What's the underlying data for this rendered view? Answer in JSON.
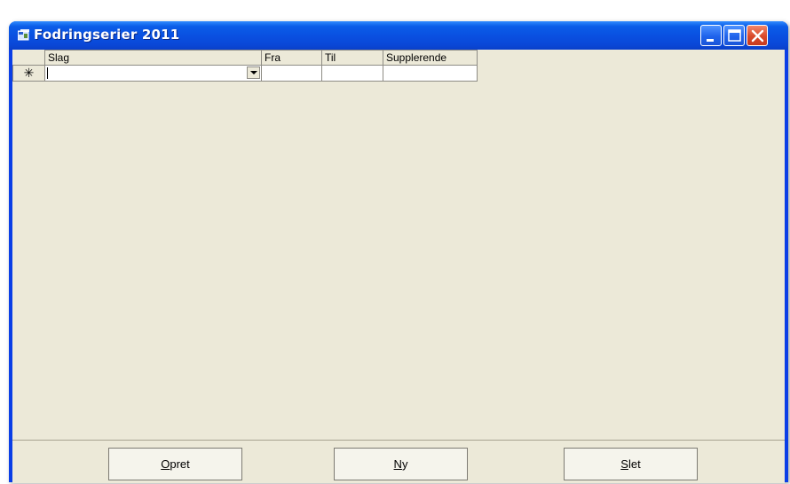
{
  "window": {
    "title": "Fodringserier 2011"
  },
  "grid": {
    "columns": [
      "Slag",
      "Fra",
      "Til",
      "Supplerende"
    ],
    "new_row_marker": "✳",
    "new_row": {
      "slag": "",
      "fra": "",
      "til": "",
      "supplerende": ""
    }
  },
  "buttons": {
    "opret": {
      "accel": "O",
      "rest": "pret"
    },
    "ny": {
      "accel": "N",
      "rest": "y"
    },
    "slet": {
      "accel": "S",
      "rest": "let"
    }
  },
  "colors": {
    "titlebar": "#0a4fe0",
    "client": "#ece9d8",
    "close_button": "#d8492b"
  }
}
